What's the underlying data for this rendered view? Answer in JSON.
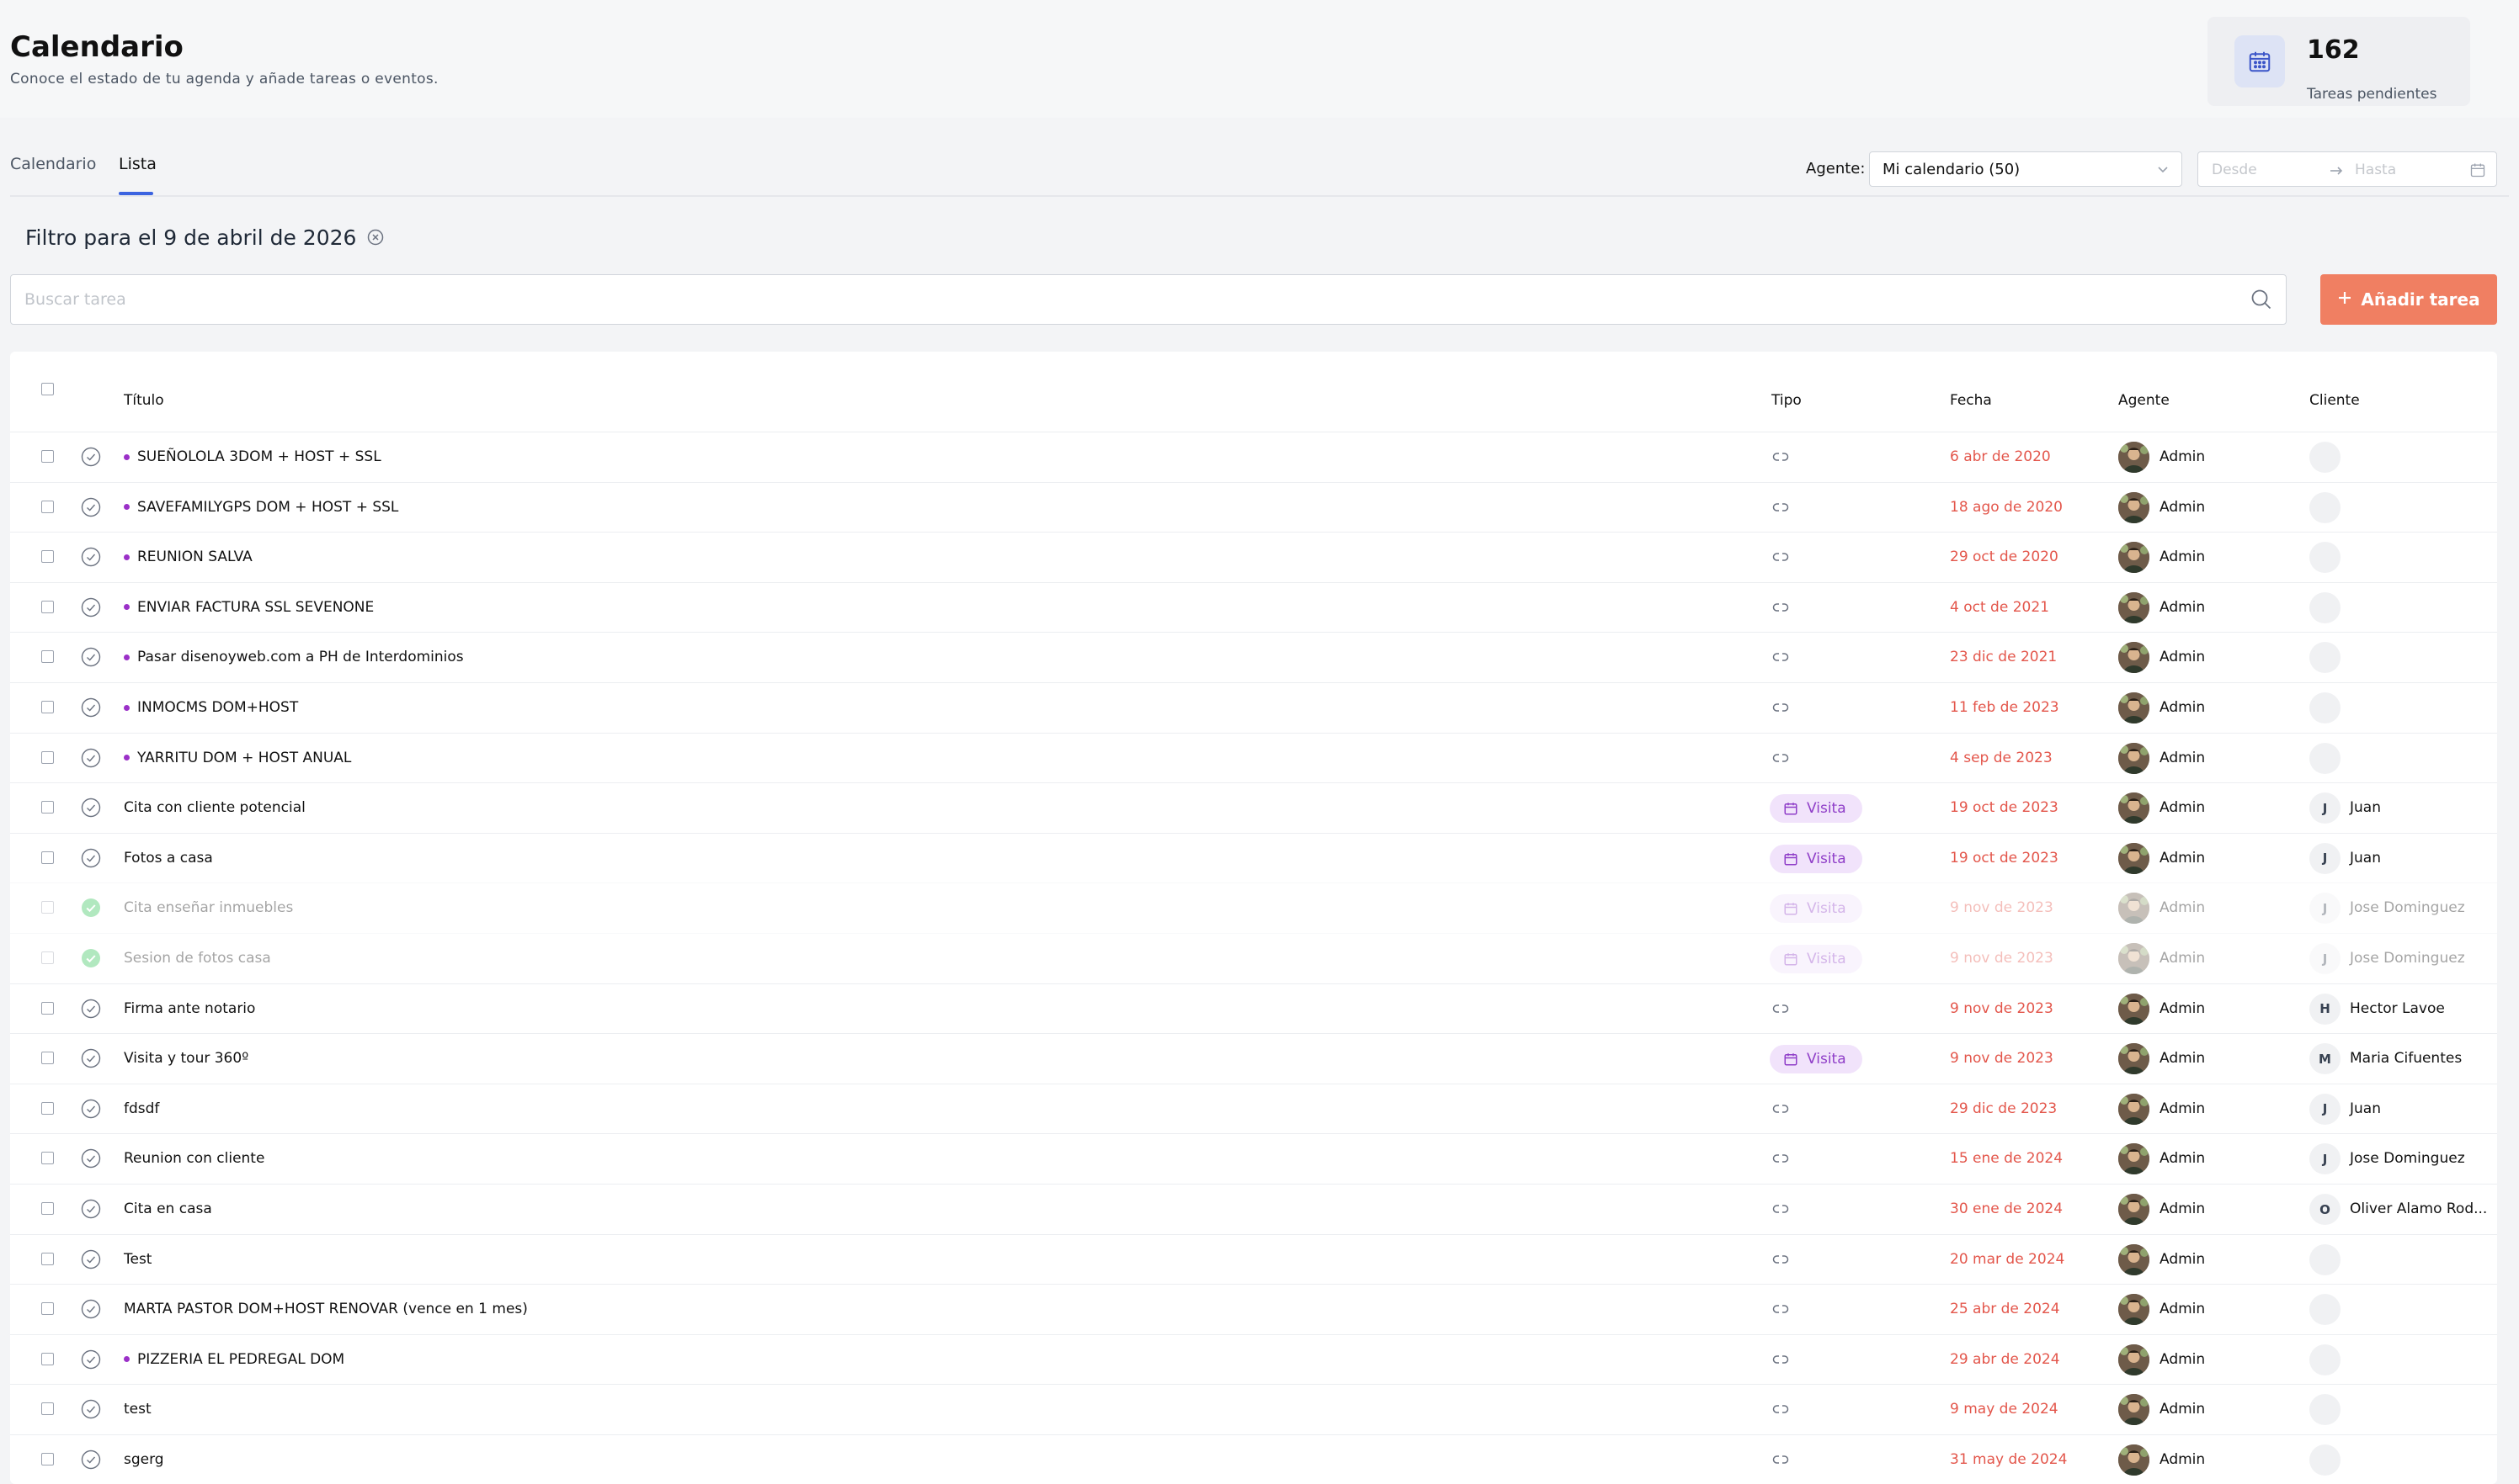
{
  "header": {
    "title": "Calendario",
    "subtitle": "Conoce el estado de tu agenda y añade tareas o eventos.",
    "stat_number": "162",
    "stat_label": "Tareas pendientes"
  },
  "tabs": [
    {
      "label": "Calendario",
      "active": false
    },
    {
      "label": "Lista",
      "active": true
    }
  ],
  "filters": {
    "agent_label": "Agente:",
    "agent_value": "Mi calendario (50)",
    "date_from_placeholder": "Desde",
    "date_to_placeholder": "Hasta"
  },
  "filter_title": "Filtro para el 9 de abril de 2026",
  "search": {
    "placeholder": "Buscar tarea"
  },
  "add_button_label": "Añadir tarea",
  "table": {
    "headers": {
      "title": "Título",
      "type": "Tipo",
      "date": "Fecha",
      "agent": "Agente",
      "client": "Cliente"
    },
    "rows": [
      {
        "title": "SUEÑOLOLA 3DOM + HOST + SSL",
        "dot": true,
        "type": "icon",
        "date": "6 abr de 2020",
        "agent": "Admin",
        "client_initial": "",
        "client": "",
        "done": false
      },
      {
        "title": "SAVEFAMILYGPS DOM + HOST + SSL",
        "dot": true,
        "type": "icon",
        "date": "18 ago de 2020",
        "agent": "Admin",
        "client_initial": "",
        "client": "",
        "done": false
      },
      {
        "title": "REUNION SALVA",
        "dot": true,
        "type": "icon",
        "date": "29 oct de 2020",
        "agent": "Admin",
        "client_initial": "",
        "client": "",
        "done": false
      },
      {
        "title": "ENVIAR FACTURA SSL SEVENONE",
        "dot": true,
        "type": "icon",
        "date": "4 oct de 2021",
        "agent": "Admin",
        "client_initial": "",
        "client": "",
        "done": false
      },
      {
        "title": "Pasar disenoyweb.com a PH de Interdominios",
        "dot": true,
        "type": "icon",
        "date": "23 dic de 2021",
        "agent": "Admin",
        "client_initial": "",
        "client": "",
        "done": false
      },
      {
        "title": "INMOCMS DOM+HOST",
        "dot": true,
        "type": "icon",
        "date": "11 feb de 2023",
        "agent": "Admin",
        "client_initial": "",
        "client": "",
        "done": false
      },
      {
        "title": "YARRITU DOM + HOST ANUAL",
        "dot": true,
        "type": "icon",
        "date": "4 sep de 2023",
        "agent": "Admin",
        "client_initial": "",
        "client": "",
        "done": false
      },
      {
        "title": "Cita con cliente potencial",
        "dot": false,
        "type": "Visita",
        "date": "19 oct de 2023",
        "agent": "Admin",
        "client_initial": "J",
        "client": "Juan",
        "done": false
      },
      {
        "title": "Fotos a casa",
        "dot": false,
        "type": "Visita",
        "date": "19 oct de 2023",
        "agent": "Admin",
        "client_initial": "J",
        "client": "Juan",
        "done": false
      },
      {
        "title": "Cita enseñar inmuebles",
        "dot": false,
        "type": "Visita",
        "date": "9 nov de 2023",
        "agent": "Admin",
        "client_initial": "J",
        "client": "Jose Dominguez",
        "done": true
      },
      {
        "title": "Sesion de fotos casa",
        "dot": false,
        "type": "Visita",
        "date": "9 nov de 2023",
        "agent": "Admin",
        "client_initial": "J",
        "client": "Jose Dominguez",
        "done": true
      },
      {
        "title": "Firma ante notario",
        "dot": false,
        "type": "icon",
        "date": "9 nov de 2023",
        "agent": "Admin",
        "client_initial": "H",
        "client": "Hector Lavoe",
        "done": false
      },
      {
        "title": "Visita y tour 360º",
        "dot": false,
        "type": "Visita",
        "date": "9 nov de 2023",
        "agent": "Admin",
        "client_initial": "M",
        "client": "Maria Cifuentes",
        "done": false
      },
      {
        "title": "fdsdf",
        "dot": false,
        "type": "icon",
        "date": "29 dic de 2023",
        "agent": "Admin",
        "client_initial": "J",
        "client": "Juan",
        "done": false
      },
      {
        "title": "Reunion con cliente",
        "dot": false,
        "type": "icon",
        "date": "15 ene de 2024",
        "agent": "Admin",
        "client_initial": "J",
        "client": "Jose Dominguez",
        "done": false
      },
      {
        "title": "Cita en casa",
        "dot": false,
        "type": "icon",
        "date": "30 ene de 2024",
        "agent": "Admin",
        "client_initial": "O",
        "client": "Oliver Alamo Rod...",
        "done": false
      },
      {
        "title": "Test",
        "dot": false,
        "type": "icon",
        "date": "20 mar de 2024",
        "agent": "Admin",
        "client_initial": "",
        "client": "",
        "done": false
      },
      {
        "title": "MARTA PASTOR DOM+HOST RENOVAR (vence en 1 mes)",
        "dot": false,
        "type": "icon",
        "date": "25 abr de 2024",
        "agent": "Admin",
        "client_initial": "",
        "client": "",
        "done": false
      },
      {
        "title": "PIZZERIA EL PEDREGAL DOM",
        "dot": true,
        "type": "icon",
        "date": "29 abr de 2024",
        "agent": "Admin",
        "client_initial": "",
        "client": "",
        "done": false
      },
      {
        "title": "test",
        "dot": false,
        "type": "icon",
        "date": "9 may de 2024",
        "agent": "Admin",
        "client_initial": "",
        "client": "",
        "done": false
      },
      {
        "title": "sgerg",
        "dot": false,
        "type": "icon",
        "date": "31 may de 2024",
        "agent": "Admin",
        "client_initial": "",
        "client": "",
        "done": false
      }
    ]
  },
  "colors": {
    "accent": "#3b63e0",
    "add_button": "#f07f62",
    "overdue_date": "#e3564b",
    "task_dot": "#9b30c8",
    "visita_badge_bg": "#f1e3fb",
    "visita_badge_text": "#8f3ec8",
    "done_check": "#34c35a"
  },
  "icons": [
    "calendar-icon",
    "chevron-down-icon",
    "arrow-right-icon",
    "close-circle-icon",
    "search-icon",
    "plus-icon",
    "check-circle-icon",
    "link-icon",
    "avatar"
  ]
}
